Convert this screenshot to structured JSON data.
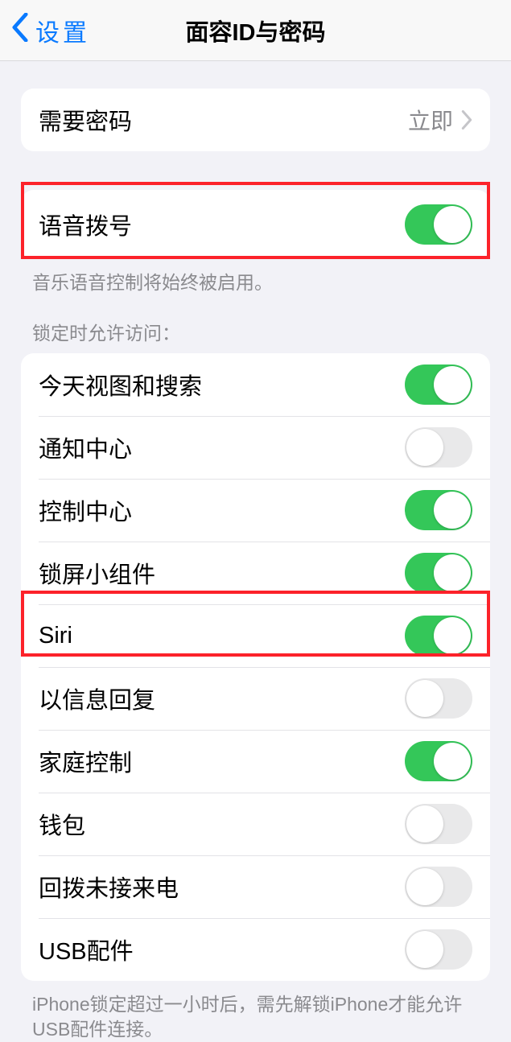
{
  "nav": {
    "back_label": "设置",
    "title": "面容ID与密码"
  },
  "require_passcode": {
    "label": "需要密码",
    "value": "立即"
  },
  "voice_dial": {
    "label": "语音拨号",
    "footer": "音乐语音控制将始终被启用。"
  },
  "locked_access": {
    "header": "锁定时允许访问：",
    "items": [
      {
        "label": "今天视图和搜索",
        "on": true
      },
      {
        "label": "通知中心",
        "on": false
      },
      {
        "label": "控制中心",
        "on": true
      },
      {
        "label": "锁屏小组件",
        "on": true
      },
      {
        "label": "Siri",
        "on": true
      },
      {
        "label": "以信息回复",
        "on": false
      },
      {
        "label": "家庭控制",
        "on": true
      },
      {
        "label": "钱包",
        "on": false
      },
      {
        "label": "回拨未接来电",
        "on": false
      },
      {
        "label": "USB配件",
        "on": false
      }
    ],
    "footer": "iPhone锁定超过一小时后，需先解锁iPhone才能允许USB配件连接。"
  }
}
